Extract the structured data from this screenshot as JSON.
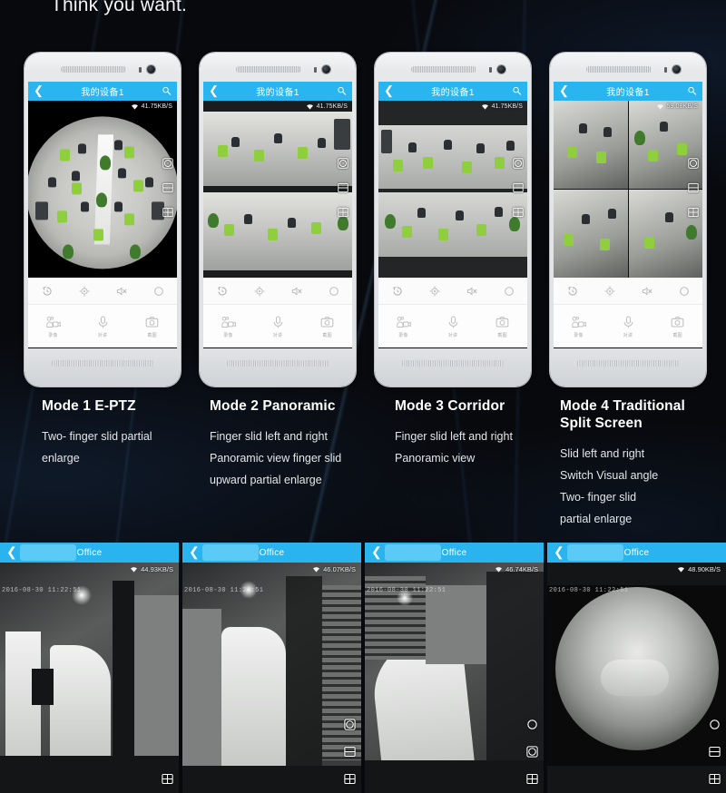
{
  "headline": "Think you want.",
  "phones": [
    {
      "appbar": {
        "title": "我的设备1",
        "back_icon": "chevron-left-icon",
        "search_icon": "search-icon"
      },
      "net_speed": "41.75KB/S",
      "wifi_icon": "wifi-icon",
      "mode": "fisheye",
      "side_icons": [
        "fisheye-view-icon",
        "split-horizontal-view-icon",
        "quad-view-icon"
      ],
      "controls": [
        "playback-icon",
        "ptz-icon",
        "mute-icon",
        "fullscreen-icon"
      ],
      "actions": [
        {
          "icon": "record-video-icon",
          "label": "录像"
        },
        {
          "icon": "microphone-icon",
          "label": "对讲"
        },
        {
          "icon": "camera-snapshot-icon",
          "label": "截图"
        }
      ],
      "navbar": [
        "back-nav-icon",
        "home-nav-icon",
        "recents-nav-icon"
      ]
    },
    {
      "appbar": {
        "title": "我的设备1",
        "back_icon": "chevron-left-icon",
        "search_icon": "search-icon"
      },
      "net_speed": "41.75KB/S",
      "wifi_icon": "wifi-icon",
      "mode": "panoramic",
      "side_icons": [
        "fisheye-view-icon",
        "split-horizontal-view-icon",
        "quad-view-icon"
      ],
      "controls": [
        "playback-icon",
        "ptz-icon",
        "mute-icon",
        "fullscreen-icon"
      ],
      "actions": [
        {
          "icon": "record-video-icon",
          "label": "录像"
        },
        {
          "icon": "microphone-icon",
          "label": "对讲"
        },
        {
          "icon": "camera-snapshot-icon",
          "label": "截图"
        }
      ],
      "navbar": [
        "back-nav-icon",
        "home-nav-icon",
        "recents-nav-icon"
      ]
    },
    {
      "appbar": {
        "title": "我的设备1",
        "back_icon": "chevron-left-icon",
        "search_icon": "search-icon"
      },
      "net_speed": "41.75KB/S",
      "wifi_icon": "wifi-icon",
      "mode": "corridor",
      "side_icons": [
        "fisheye-view-icon",
        "split-horizontal-view-icon",
        "quad-view-icon"
      ],
      "controls": [
        "playback-icon",
        "ptz-icon",
        "mute-icon",
        "fullscreen-icon"
      ],
      "actions": [
        {
          "icon": "record-video-icon",
          "label": "录像"
        },
        {
          "icon": "microphone-icon",
          "label": "对讲"
        },
        {
          "icon": "camera-snapshot-icon",
          "label": "截图"
        }
      ],
      "navbar": [
        "back-nav-icon",
        "home-nav-icon",
        "recents-nav-icon"
      ]
    },
    {
      "appbar": {
        "title": "我的设备1",
        "back_icon": "chevron-left-icon",
        "search_icon": "search-icon"
      },
      "net_speed": "59.08KB/S",
      "wifi_icon": "wifi-icon",
      "mode": "split",
      "side_icons": [
        "fisheye-view-icon",
        "split-horizontal-view-icon",
        "quad-view-icon"
      ],
      "controls": [
        "playback-icon",
        "ptz-icon",
        "mute-icon",
        "fullscreen-icon"
      ],
      "actions": [
        {
          "icon": "record-video-icon",
          "label": "录像"
        },
        {
          "icon": "microphone-icon",
          "label": "对讲"
        },
        {
          "icon": "camera-snapshot-icon",
          "label": "截图"
        }
      ],
      "navbar": [
        "back-nav-icon",
        "home-nav-icon",
        "recents-nav-icon"
      ]
    }
  ],
  "captions": [
    {
      "title": "Mode 1 E-PTZ",
      "lines": [
        "Two- finger slid partial",
        "enlarge"
      ]
    },
    {
      "title": "Mode 2 Panoramic",
      "lines": [
        "Finger slid left and right",
        "Panoramic view finger slid",
        "upward partial enlarge"
      ]
    },
    {
      "title": "Mode 3 Corridor",
      "lines": [
        "Finger slid left and right",
        "Panoramic view"
      ]
    },
    {
      "title": "Mode 4 Traditional Split Screen",
      "lines": [
        "Slid left and right",
        "Switch Visual angle",
        "Two- finger slid",
        "partial enlarge"
      ]
    }
  ],
  "panels": [
    {
      "title": "Office",
      "back_icon": "chevron-left-icon",
      "net_speed": "44.93KB/S",
      "wifi_icon": "wifi-icon",
      "timestamp": "2016-08-30 11:22:51",
      "mode": "quad",
      "side_icons": [
        "quad-view-icon"
      ]
    },
    {
      "title": "Office",
      "back_icon": "chevron-left-icon",
      "net_speed": "46.07KB/S",
      "wifi_icon": "wifi-icon",
      "timestamp": "2016-08-30 11:22:51",
      "mode": "split-horizontal",
      "side_icons": [
        "fisheye-view-icon",
        "split-horizontal-view-icon",
        "quad-view-icon"
      ]
    },
    {
      "title": "Office",
      "back_icon": "chevron-left-icon",
      "net_speed": "46.74KB/S",
      "wifi_icon": "wifi-icon",
      "timestamp": "2016-08-30 11:22:51",
      "mode": "corridor",
      "side_icons": [
        "ptz-icon",
        "fisheye-view-icon",
        "quad-view-icon"
      ]
    },
    {
      "title": "Office",
      "back_icon": "chevron-left-icon",
      "net_speed": "48.90KB/S",
      "wifi_icon": "wifi-icon",
      "timestamp": "2016-08-30 11:22:51",
      "mode": "fisheye",
      "side_icons": [
        "ptz-icon",
        "split-horizontal-view-icon",
        "quad-view-icon"
      ]
    }
  ],
  "colors": {
    "appbar_blue": "#29b6f0",
    "panel_blue": "#2ab4ef",
    "background": "#08090d",
    "text": "#eceef0"
  }
}
